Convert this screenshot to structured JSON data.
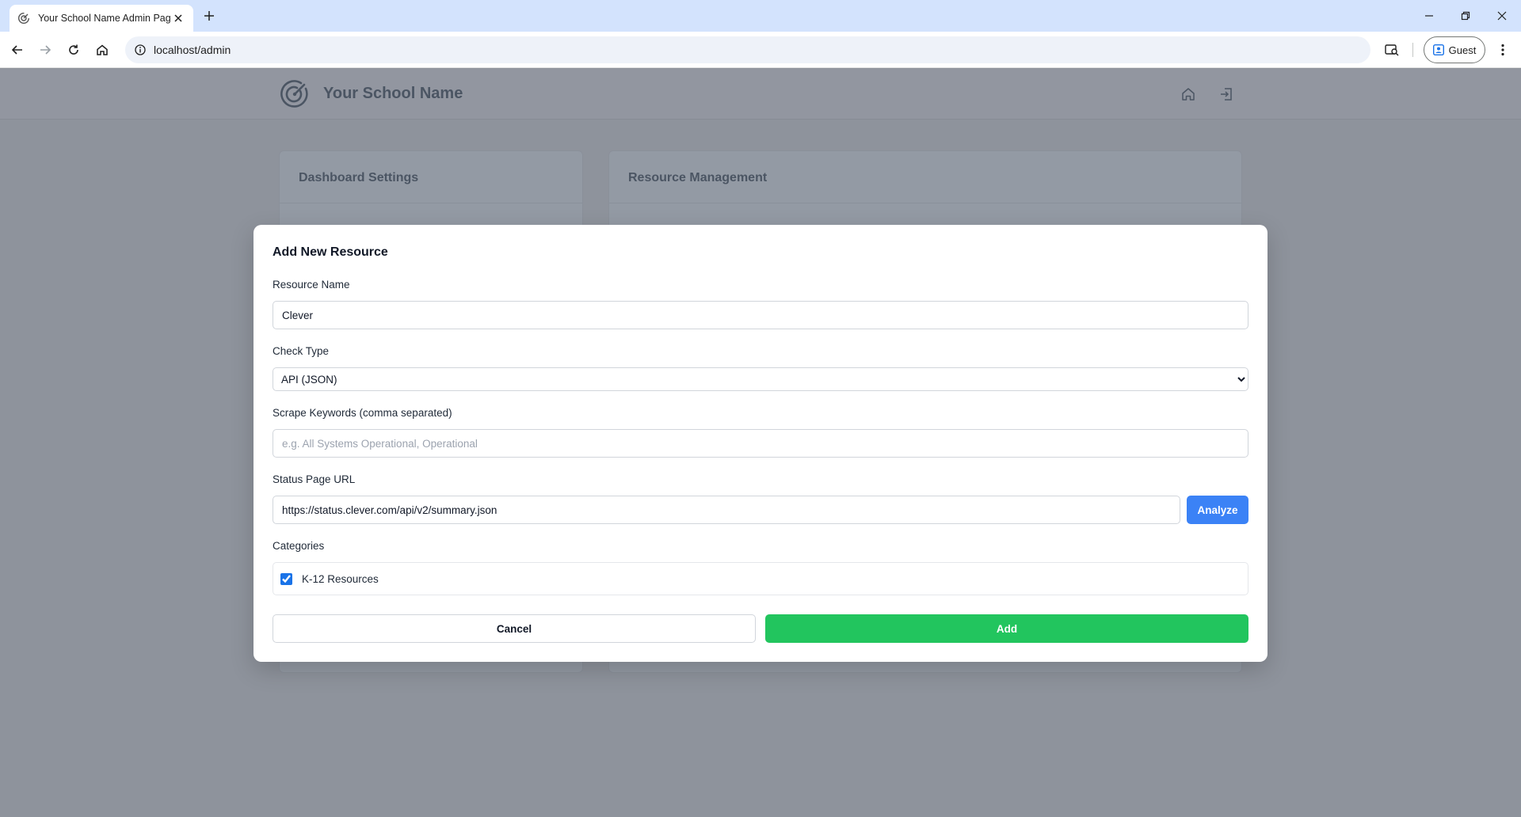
{
  "browser": {
    "tab_title": "Your School Name Admin Page",
    "url": "localhost/admin",
    "profile_label": "Guest"
  },
  "site": {
    "name": "Your School Name",
    "logo_icon": "radar-icon",
    "header_icons": [
      "home-icon",
      "sign-in-icon"
    ]
  },
  "cards": {
    "left_title": "Dashboard Settings",
    "right_title": "Resource Management"
  },
  "modal": {
    "title": "Add New Resource",
    "resource_name_label": "Resource Name",
    "resource_name_value": "Clever",
    "check_type_label": "Check Type",
    "check_type_selected": "API (JSON)",
    "keywords_label": "Scrape Keywords (comma separated)",
    "keywords_placeholder": "e.g. All Systems Operational, Operational",
    "status_url_label": "Status Page URL",
    "status_url_value": "https://status.clever.com/api/v2/summary.json",
    "analyze_label": "Analyze",
    "categories_label": "Categories",
    "categories": [
      {
        "label": "K-12 Resources",
        "checked": true
      }
    ],
    "cancel_label": "Cancel",
    "add_label": "Add"
  },
  "colors": {
    "analyze": "#3b82f6",
    "add": "#22c55e",
    "overlay": "#8e939c"
  }
}
